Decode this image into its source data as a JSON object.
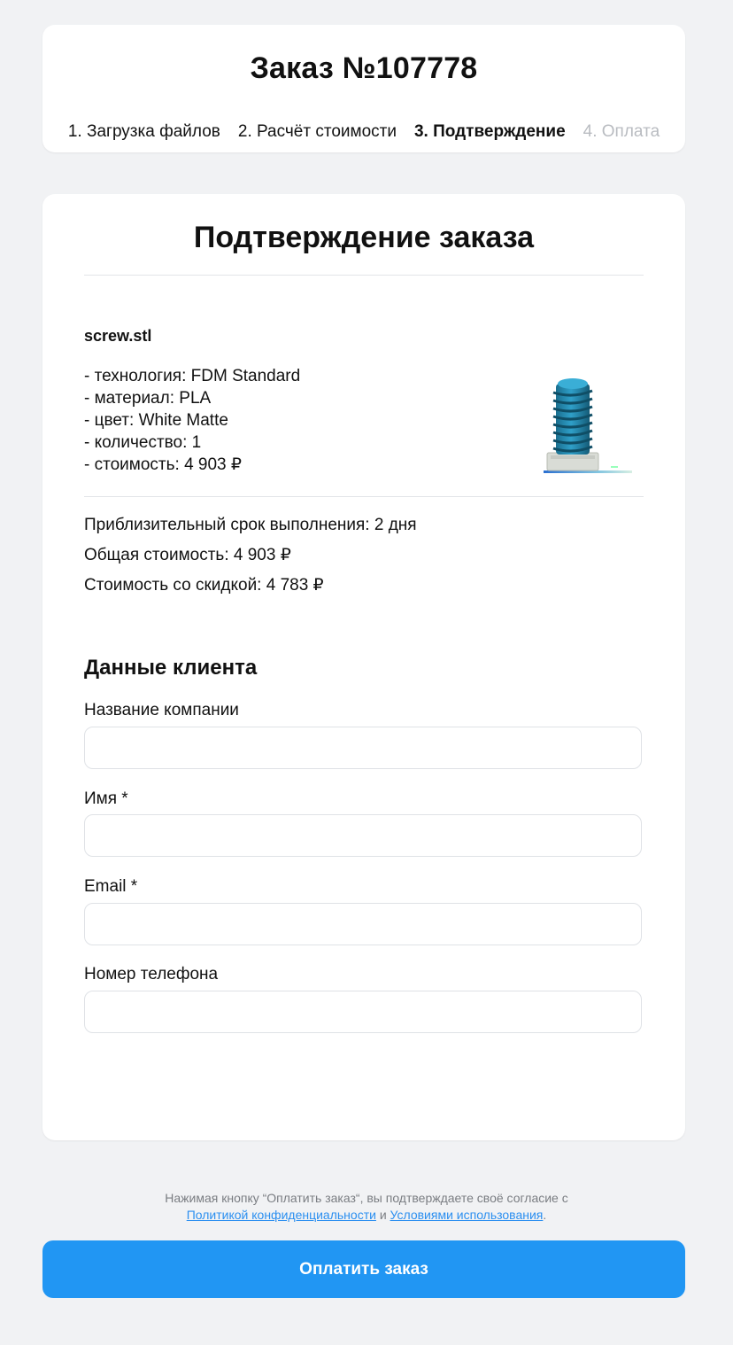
{
  "header": {
    "order_title": "Заказ №107778",
    "steps": [
      {
        "label": "1. Загрузка файлов"
      },
      {
        "label": "2. Расчёт стоимости"
      },
      {
        "label": "3. Подтверждение"
      },
      {
        "label": "4. Оплата"
      }
    ],
    "active_step": 3
  },
  "confirmation": {
    "title": "Подтверждение заказа",
    "file": {
      "name": "screw.stl",
      "specs": [
        "- технология: FDM Standard",
        "- материал: PLA",
        "- цвет: White Matte",
        "- количество: 1",
        "- стоимость: 4 903 ₽"
      ],
      "thumbnail_icon": "screw-model-preview-icon"
    },
    "summary": {
      "lead_time": "Приблизительный срок выполнения: 2 дня",
      "total": "Общая стоимость: 4 903 ₽",
      "discounted": "Стоимость со скидкой: 4 783 ₽"
    }
  },
  "client": {
    "title": "Данные клиента",
    "fields": {
      "company": {
        "label": "Название компании",
        "value": "",
        "placeholder": ""
      },
      "name": {
        "label": "Имя *",
        "value": "",
        "placeholder": ""
      },
      "email": {
        "label": "Email *",
        "value": "",
        "placeholder": ""
      },
      "phone": {
        "label": "Номер телефона",
        "value": "",
        "placeholder": ""
      }
    }
  },
  "footer": {
    "consent_prefix": "Нажимая кнопку “Оплатить заказ“, вы подтверждаете своё согласие с",
    "privacy_link": "Политикой конфиденциальности",
    "and_word": "и",
    "terms_link": "Условиями использования",
    "period": ".",
    "pay_button": "Оплатить заказ"
  },
  "colors": {
    "accent": "#2196f3",
    "background": "#f1f2f4",
    "step_disabled": "#b9bcc1",
    "link": "#2b8ff0"
  }
}
